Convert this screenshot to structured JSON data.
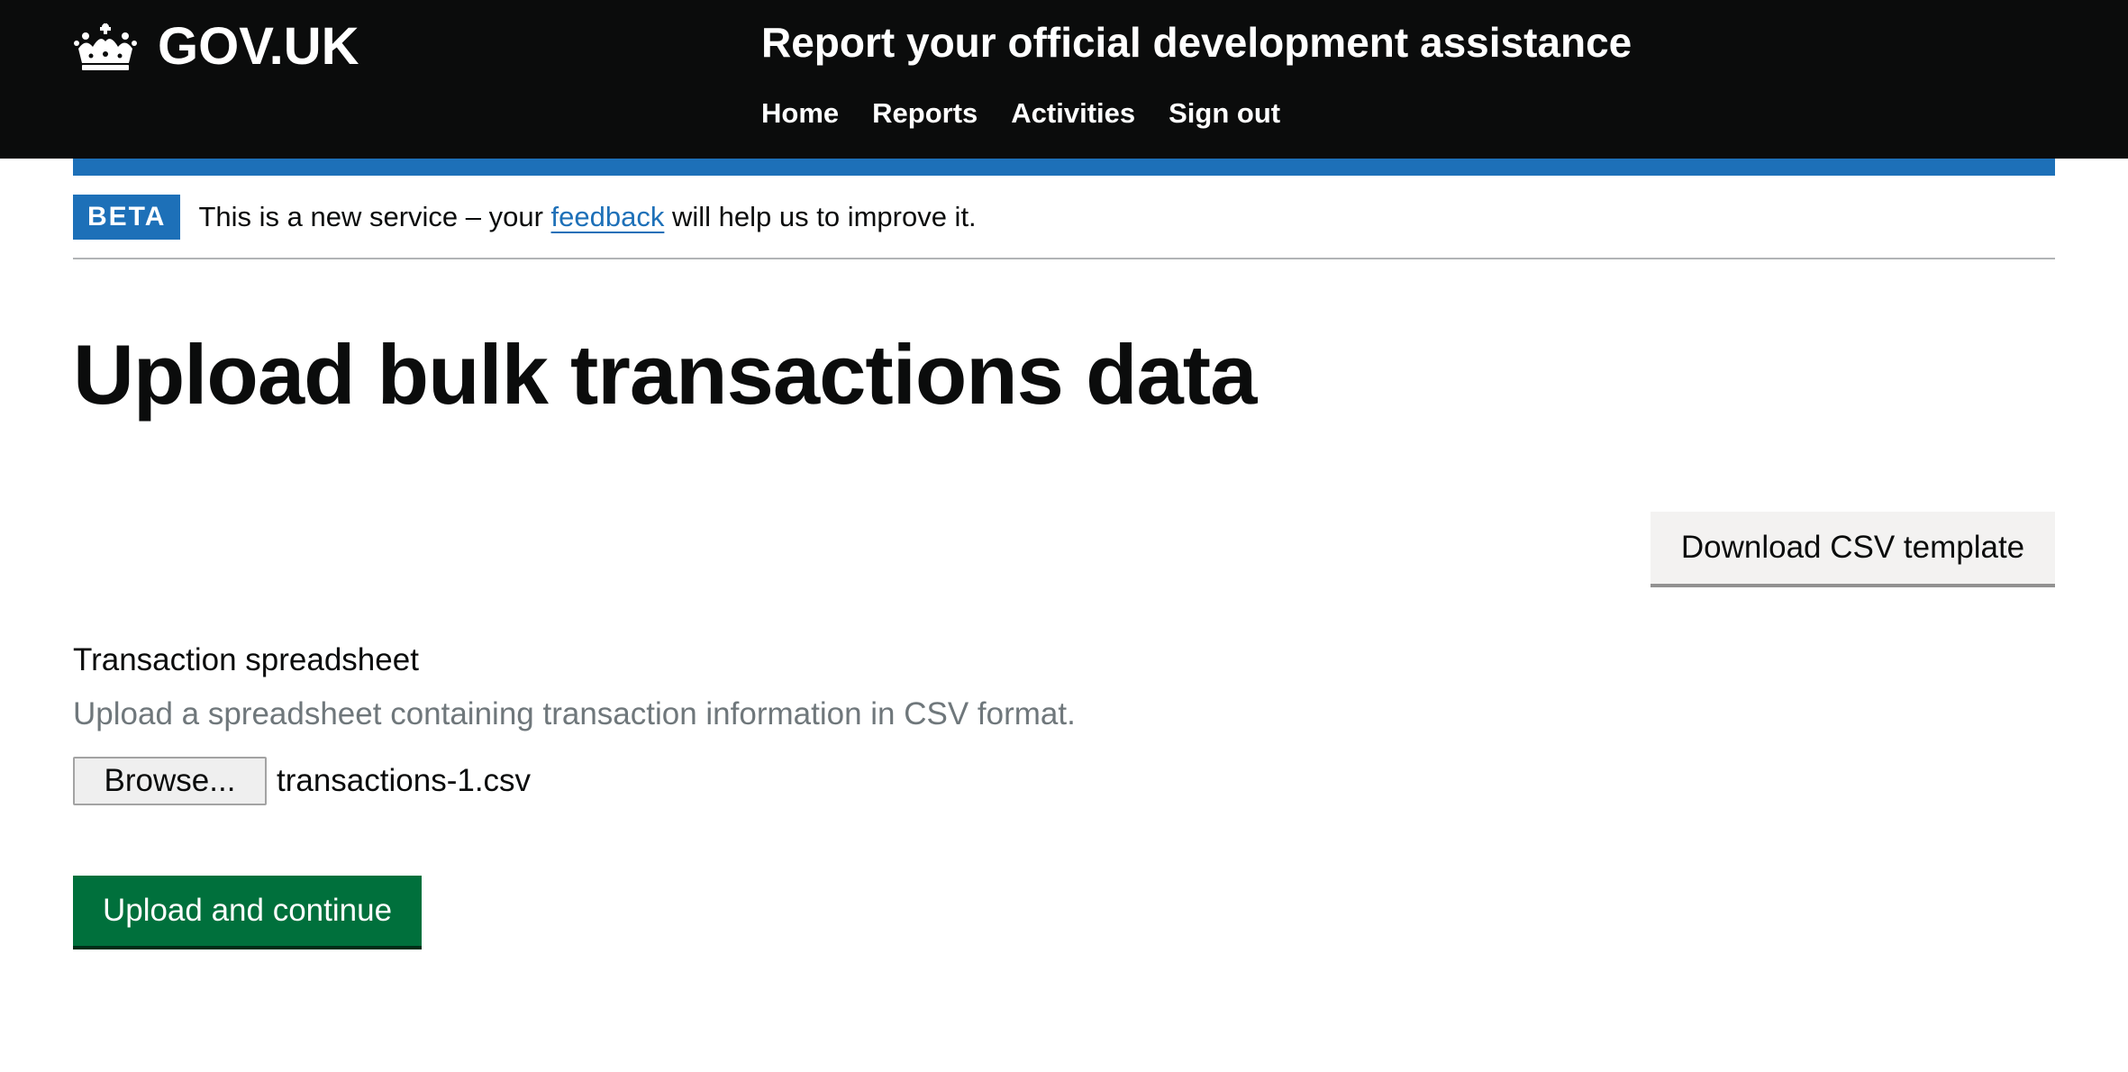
{
  "header": {
    "logo_text": "GOV.UK",
    "logo_icon": "crown-icon",
    "service_name": "Report your official development assistance",
    "nav": [
      {
        "label": "Home"
      },
      {
        "label": "Reports"
      },
      {
        "label": "Activities"
      },
      {
        "label": "Sign out"
      }
    ]
  },
  "phase_banner": {
    "tag": "BETA",
    "text_before": "This is a new service – your ",
    "link": "feedback",
    "text_after": " will help us to improve it."
  },
  "main": {
    "title": "Upload bulk transactions data",
    "download_button": "Download CSV template",
    "upload": {
      "label": "Transaction spreadsheet",
      "hint": "Upload a spreadsheet containing transaction information in CSV format.",
      "browse_label": "Browse...",
      "file_name": "transactions-1.csv"
    },
    "submit_button": "Upload and continue"
  },
  "colors": {
    "header_bg": "#0b0c0c",
    "brand_blue": "#1d70b8",
    "primary_green": "#00703c",
    "hint_grey": "#6f777b"
  }
}
